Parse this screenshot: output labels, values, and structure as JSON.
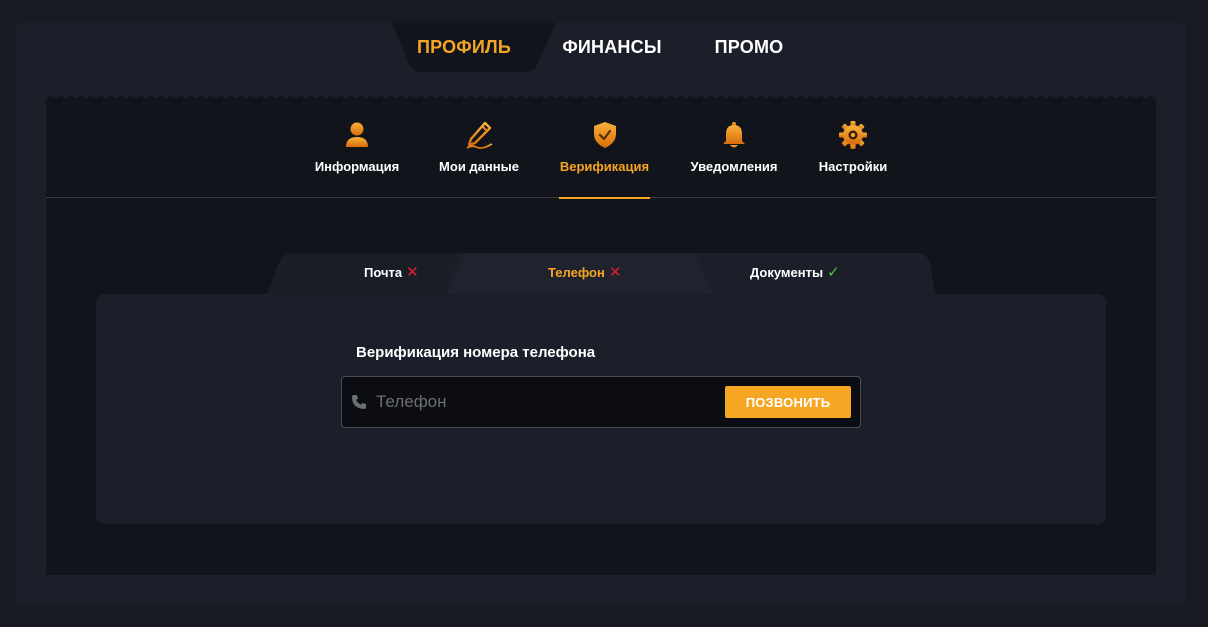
{
  "top_tabs": [
    {
      "label": "ПРОФИЛЬ",
      "active": true
    },
    {
      "label": "ФИНАНСЫ",
      "active": false
    },
    {
      "label": "ПРОМО",
      "active": false
    }
  ],
  "sub_nav": [
    {
      "label": "Информация",
      "icon": "user-icon"
    },
    {
      "label": "Мои данные",
      "icon": "pencil-icon"
    },
    {
      "label": "Верификация",
      "icon": "shield-check-icon",
      "active": true
    },
    {
      "label": "Уведомления",
      "icon": "bell-icon"
    },
    {
      "label": "Настройки",
      "icon": "gear-icon"
    }
  ],
  "verification_tabs": [
    {
      "label": "Почта",
      "status": "✕",
      "status_type": "not-verified"
    },
    {
      "label": "Телефон",
      "status": "✕",
      "status_type": "not-verified",
      "active": true
    },
    {
      "label": "Документы",
      "status": "✓",
      "status_type": "verified"
    }
  ],
  "phone_section": {
    "title": "Верификация номера телефона",
    "placeholder": "Телефон",
    "value": "",
    "button_label": "ПОЗВОНИТЬ",
    "icon": "phone-icon"
  },
  "colors": {
    "accent": "#f5a623",
    "error": "#e0202a",
    "success": "#4cc23c",
    "background": "#12141b",
    "panel": "#1c1f29"
  }
}
